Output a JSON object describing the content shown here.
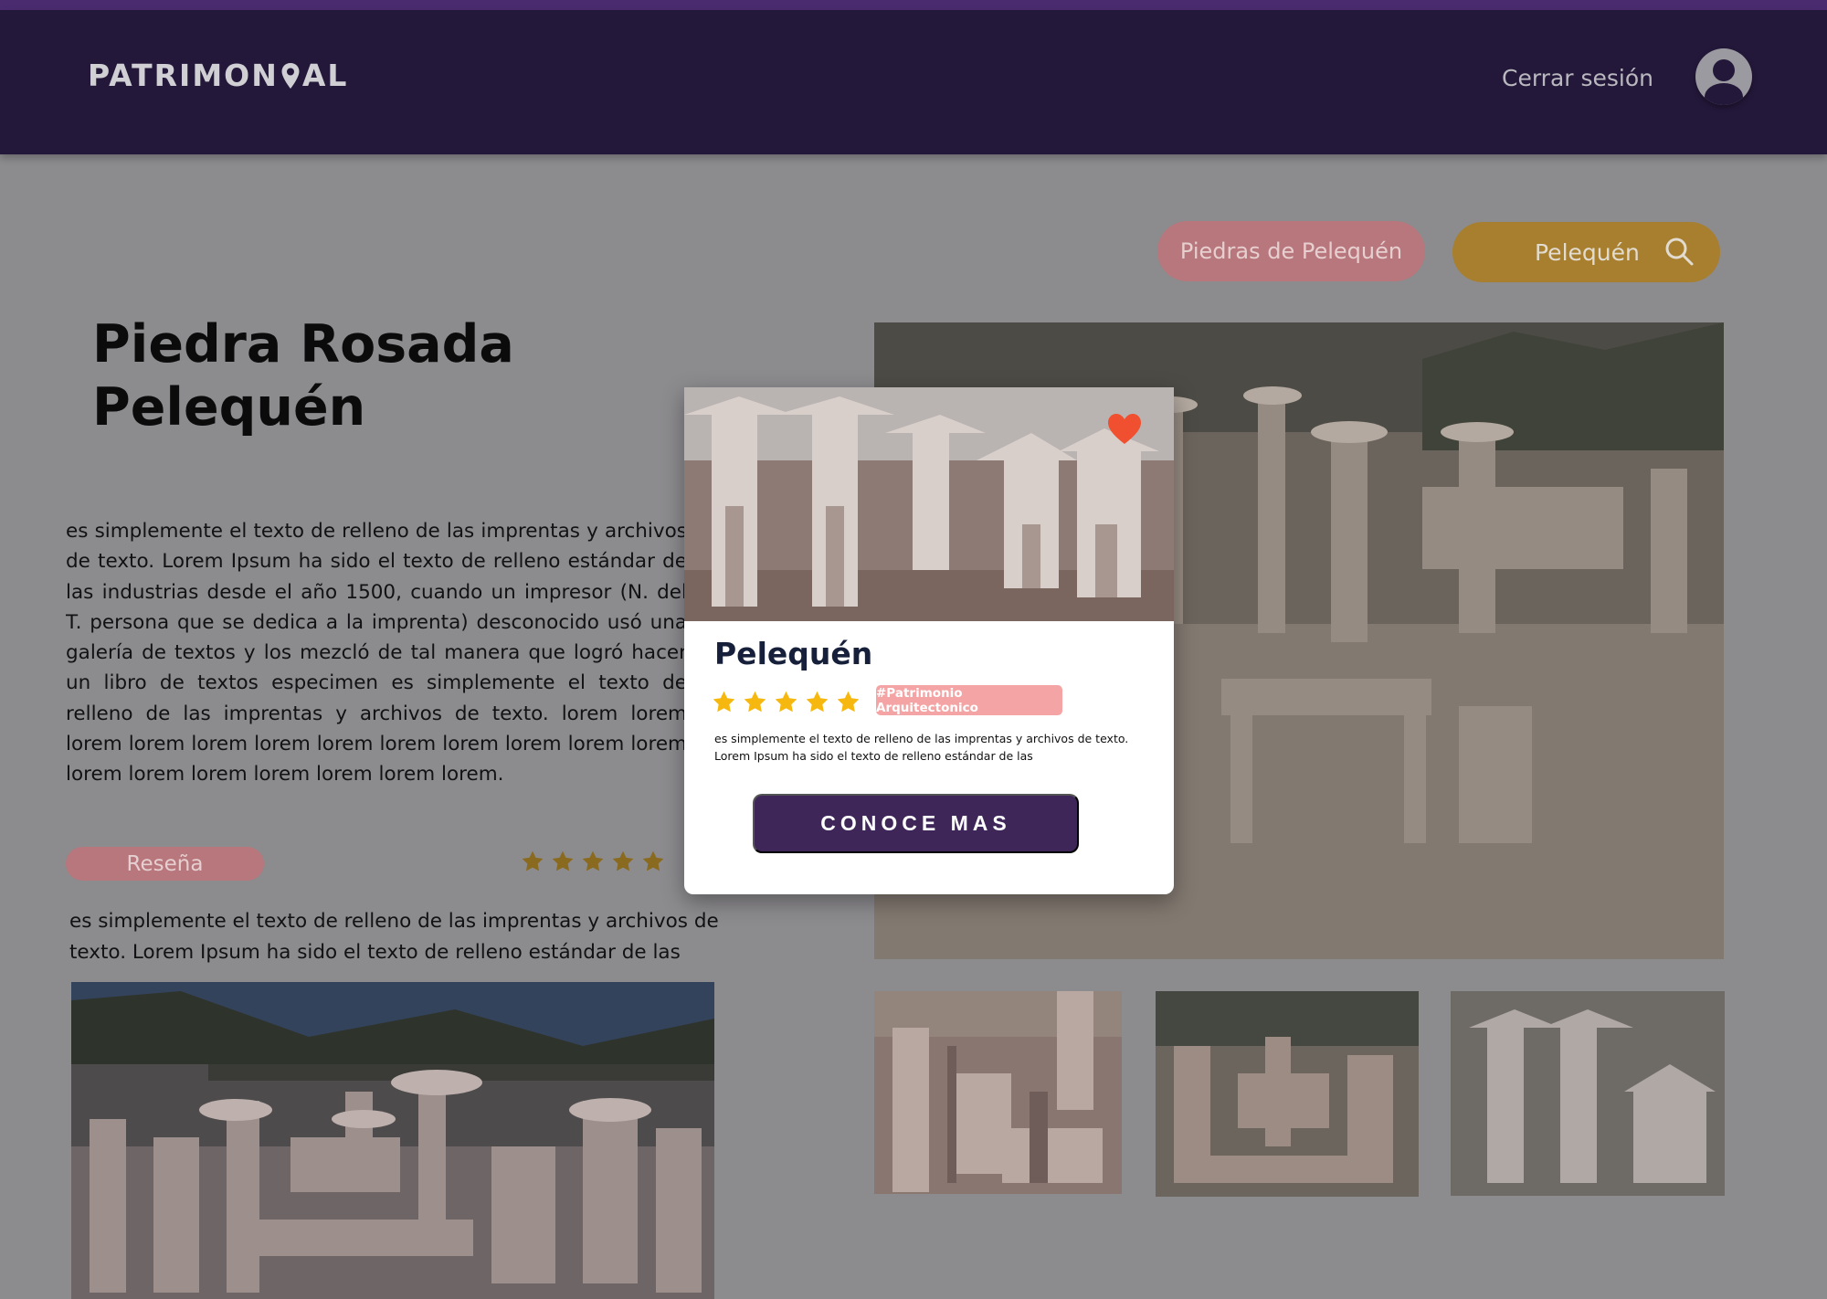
{
  "header": {
    "logo_before": "PATRIMON",
    "logo_after": "AL",
    "logout_label": "Cerrar sesión"
  },
  "filters": {
    "chip_label": "Piedras de Pelequén",
    "search_value": "Pelequén"
  },
  "place": {
    "title_line1": "Piedra Rosada",
    "title_line2": "Pelequén",
    "description": "es simplemente el texto de relleno de las imprentas y archivos de texto. Lorem Ipsum ha sido el texto de relleno estándar de las industrias desde el año 1500, cuando un impresor (N. del T. persona que se dedica a la imprenta) desconocido usó una galería de textos y los mezcló de tal manera que logró hacer un libro de textos especimen es simplemente el texto de relleno de las imprentas y archivos de texto.  lorem lorem lorem lorem lorem lorem lorem lorem lorem lorem lorem lorem lorem lorem lorem lorem lorem lorem lorem."
  },
  "review": {
    "label": "Reseña",
    "rating": 5,
    "text": "es simplemente el texto de relleno de las imprentas y archivos de texto. Lorem Ipsum ha sido el texto de relleno estándar de las"
  },
  "card": {
    "title": "Pelequén",
    "rating": 5,
    "tag": "#Patrimonio Arquitectonico",
    "text": "es simplemente el texto de relleno de las imprentas y archivos de texto. Lorem Ipsum ha sido el texto de relleno estándar de las",
    "cta_label": "CONOCE MAS",
    "favorited": true
  },
  "colors": {
    "header_bg": "#24183a",
    "accent_purple": "#3f2659",
    "chip_pink": "#f4a4a4",
    "search_gold": "#e9a72c",
    "star_gold": "#f6b80f",
    "heart_red": "#f0502f"
  }
}
